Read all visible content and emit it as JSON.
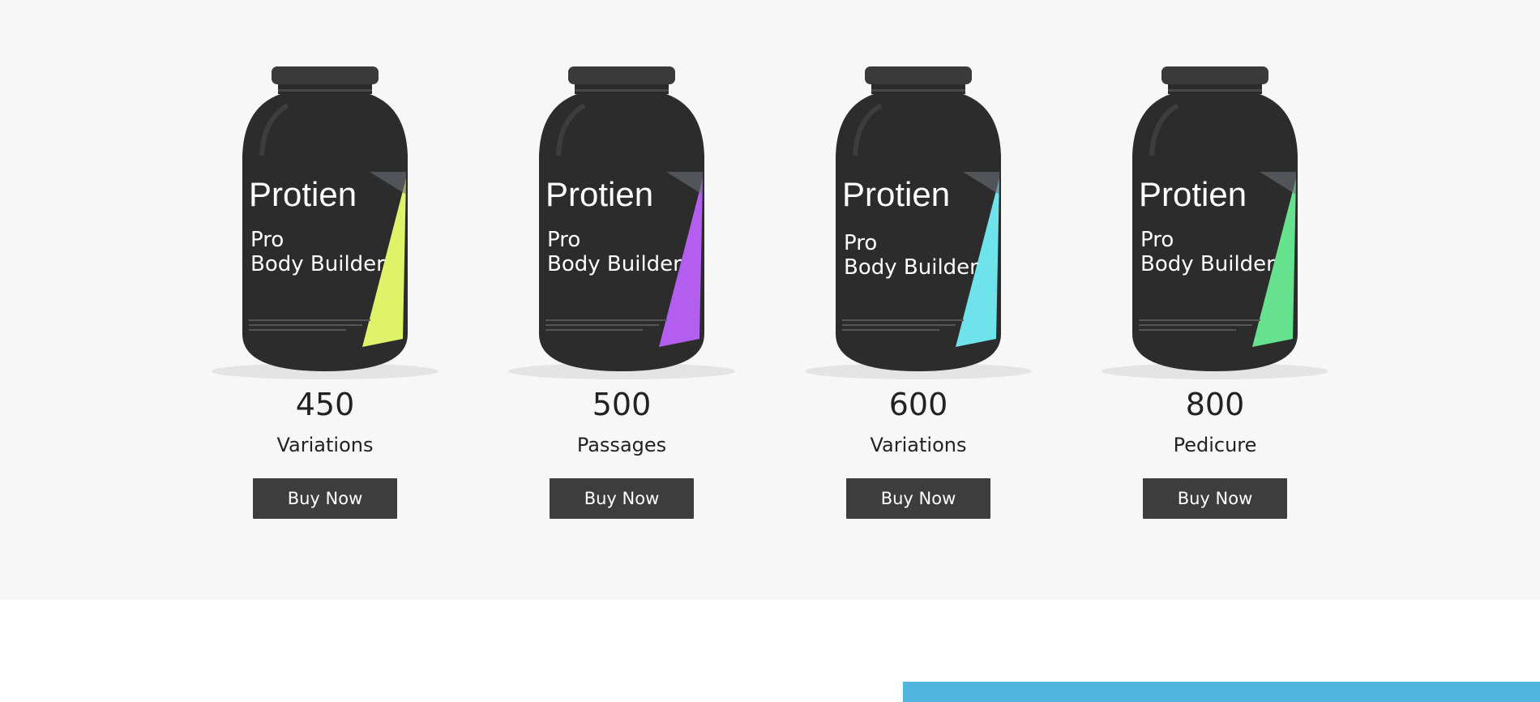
{
  "colors": {
    "section_bg": "#f7f7f7",
    "button_bg": "#3d3d3d",
    "accent_bar": "#4fb6e0"
  },
  "products": [
    {
      "brand": "Protien",
      "line1": "Pro",
      "line2": "Body Builder",
      "count": "450",
      "name": "Variations",
      "button": "Buy Now",
      "accent": "#dff26a",
      "icon": "protein-jar-icon"
    },
    {
      "brand": "Protien",
      "line1": "Pro",
      "line2": "Body Builder",
      "count": "500",
      "name": "Passages",
      "button": "Buy Now",
      "accent": "#b45ef0",
      "icon": "protein-jar-icon"
    },
    {
      "brand": "Protien",
      "line1": "Pro",
      "line2": "Body Builder",
      "count": "600",
      "name": "Variations",
      "button": "Buy Now",
      "accent": "#6fe3ec",
      "icon": "protein-jar-icon"
    },
    {
      "brand": "Protien",
      "line1": "Pro",
      "line2": "Body Builder",
      "count": "800",
      "name": "Pedicure",
      "button": "Buy Now",
      "accent": "#66e28f",
      "icon": "protein-jar-icon"
    }
  ]
}
